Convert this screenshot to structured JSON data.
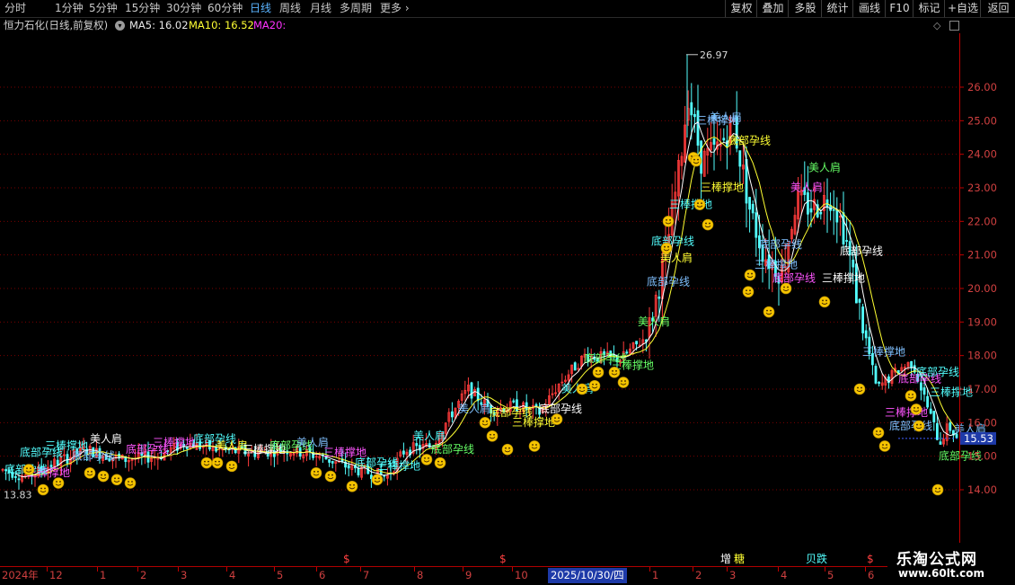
{
  "toolbar": {
    "periods": [
      "分时",
      "1分钟",
      "5分钟",
      "15分钟",
      "30分钟",
      "60分钟",
      "日线",
      "周线",
      "月线",
      "多周期",
      "更多"
    ],
    "active_period": "日线",
    "right_buttons": [
      "复权",
      "叠加",
      "多股",
      "统计",
      "画线",
      "F10",
      "标记",
      "+自选",
      "返回"
    ]
  },
  "info": {
    "title": "恒力石化(日线,前复权)",
    "ma5": "MA5: 16.02",
    "ma10": "MA10: 16.52",
    "ma20": "MA20:"
  },
  "colors": {
    "up": "#ff3b3b",
    "down": "#53ffff",
    "ma5": "#ffffff",
    "ma10": "#ffff33",
    "ma20": "#ff33ff",
    "axis": "#c00000",
    "grid": "#7a0000",
    "price_tag_bg": "#1e3aa8"
  },
  "price_axis": {
    "labels": [
      "26.00",
      "25.00",
      "24.00",
      "23.00",
      "22.00",
      "21.00",
      "20.00",
      "19.00",
      "18.00",
      "17.00",
      "16.00",
      "15.00",
      "14.00"
    ],
    "current_price": "15.53",
    "high_label": "26.97",
    "low_label": "13.83"
  },
  "time_axis": {
    "labels": [
      "2024年",
      "12",
      "1",
      "2",
      "3",
      "4",
      "5",
      "6",
      "7",
      "8",
      "9",
      "10",
      "2025/10/30/四",
      "1",
      "2",
      "3",
      "4",
      "5",
      "6"
    ],
    "highlighted": "2025/10/30/四"
  },
  "bottom_markers": [
    "$",
    "$",
    "增",
    "糖",
    "贝跌",
    "$"
  ],
  "chart_data": {
    "type": "candlestick",
    "title": "恒力石化(日线,前复权)",
    "ylim": [
      13.3,
      27.3
    ],
    "high": 26.97,
    "low": 13.83,
    "last_close": 15.53,
    "ma5_last": 16.02,
    "ma10_last": 16.52,
    "key_points": [
      {
        "x": "2024年",
        "price": 14.5
      },
      {
        "x": "12",
        "price": 15.0
      },
      {
        "x": "2",
        "price": 15.1
      },
      {
        "x": "3",
        "price": 15.3
      },
      {
        "x": "4",
        "price": 15.0
      },
      {
        "x": "6",
        "price": 14.9
      },
      {
        "x": "7",
        "price": 14.3
      },
      {
        "x": "8",
        "price": 15.5
      },
      {
        "x": "9",
        "price": 16.8
      },
      {
        "x": "10",
        "price": 16.3
      },
      {
        "x": "2025/10/30/四",
        "price": 17.0
      },
      {
        "x": "1",
        "price": 18.4
      },
      {
        "x": "2",
        "price": 26.0
      },
      {
        "x": "3",
        "price": 22.0
      },
      {
        "x": "4",
        "price": 23.0
      },
      {
        "x": "5",
        "price": 21.0
      },
      {
        "x": "6",
        "price": 15.53
      }
    ],
    "signal_labels": [
      "底部孕线",
      "三棒撑地",
      "美人肩"
    ]
  },
  "watermark": {
    "line1": "乐淘公式网",
    "line2": "www.60lt.com"
  }
}
